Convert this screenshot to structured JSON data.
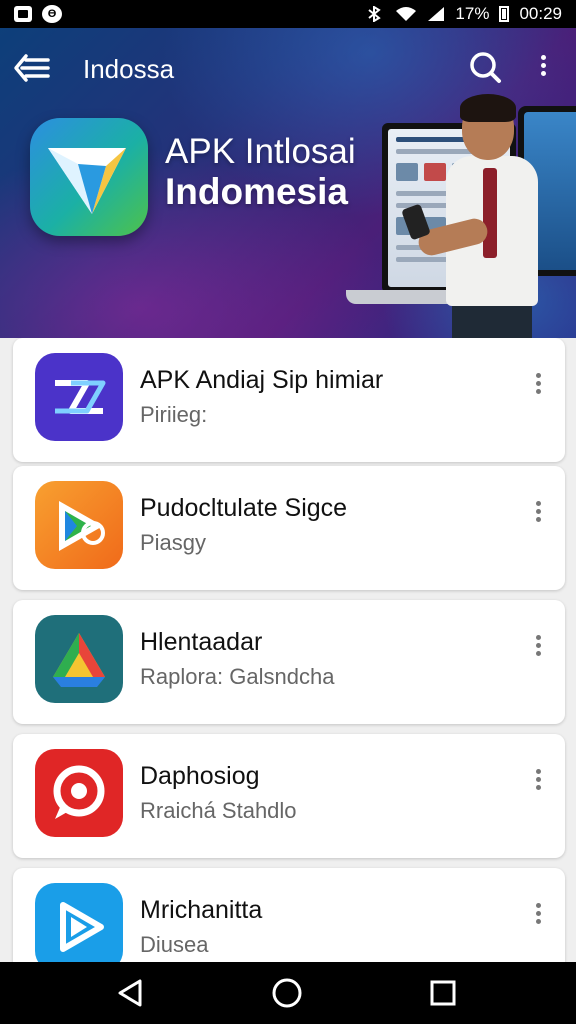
{
  "status_bar": {
    "signal_text": "17%",
    "time": "00:29"
  },
  "header": {
    "title": "Indossa",
    "hero_title_line1": "APK Intlosai",
    "hero_title_line2": "Indomesia"
  },
  "apps": [
    {
      "name": "APK Andiaj Sip himiar",
      "subtitle": "Piriieg:",
      "color": "#4b33c9"
    },
    {
      "name": "Pudocltulate Sigce",
      "subtitle": "Piasgy",
      "color": "#f47a20"
    },
    {
      "name": "Hlentaadar",
      "subtitle": "Raplora: Galsndcha",
      "color": "#1f6f7a"
    },
    {
      "name": "Daphosiog",
      "subtitle": "Rraichá Stahdlo",
      "color": "#e02626"
    },
    {
      "name": "Mrichanitta",
      "subtitle": "Diusea",
      "color": "#1a9ee8"
    }
  ],
  "icons": {
    "back": "back-arrow-icon",
    "search": "search-icon",
    "more": "more-vertical-icon",
    "nav_back": "triangle-back-icon",
    "nav_home": "circle-home-icon",
    "nav_recents": "square-recents-icon"
  }
}
